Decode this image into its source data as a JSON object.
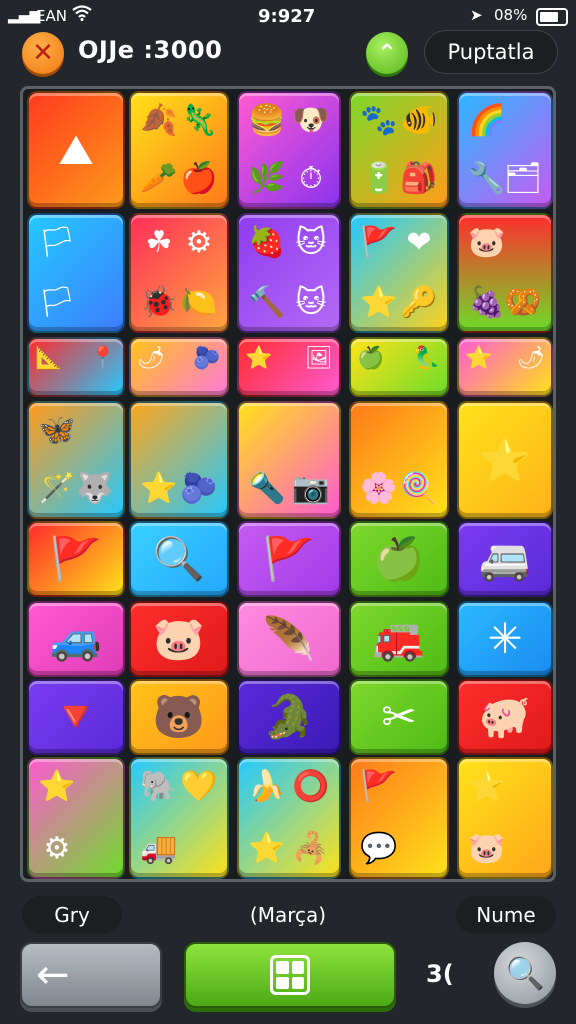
{
  "status_bar": {
    "signal": "▂▄▆",
    "carrier": "EAN",
    "wifi": "wifi",
    "time": "9:927",
    "battery": "08%"
  },
  "header": {
    "close_icon": "✕",
    "score_label": "OJJe :3000",
    "up_icon": "⌃",
    "right_button": "Puptatla"
  },
  "board": {
    "rows": [
      [
        {
          "bg": "linear-gradient(135deg,#ff3b1e,#ff9a1a)",
          "icons": [
            {
              "pos": "c",
              "glyph": "⛰"
            }
          ]
        },
        {
          "bg": "linear-gradient(135deg,#ffe21a,#ff7a1a)",
          "icons": [
            {
              "pos": "tl",
              "glyph": "🍂"
            },
            {
              "pos": "tr",
              "glyph": "🦎"
            },
            {
              "pos": "bl",
              "glyph": "🥕"
            },
            {
              "pos": "br",
              "glyph": "🍎"
            }
          ]
        },
        {
          "bg": "linear-gradient(135deg,#ff5ad1,#8a34f0)",
          "icons": [
            {
              "pos": "tl",
              "glyph": "🍔"
            },
            {
              "pos": "tr",
              "glyph": "🐶"
            },
            {
              "pos": "bl",
              "glyph": "🌿"
            },
            {
              "pos": "br",
              "glyph": "⏱"
            }
          ]
        },
        {
          "bg": "linear-gradient(135deg,#7ed82a,#ff9c1a)",
          "icons": [
            {
              "pos": "tl",
              "glyph": "🐾"
            },
            {
              "pos": "tr",
              "glyph": "🐠"
            },
            {
              "pos": "bl",
              "glyph": "🔋"
            },
            {
              "pos": "br",
              "glyph": "🎒"
            }
          ]
        },
        {
          "bg": "linear-gradient(135deg,#2ab8ff,#c95af2)",
          "icons": [
            {
              "pos": "tl",
              "glyph": "🌈"
            },
            {
              "pos": "bl",
              "glyph": "🔧"
            },
            {
              "pos": "br",
              "glyph": "🗂"
            }
          ]
        }
      ],
      [
        {
          "bg": "linear-gradient(135deg,#24c9ff,#3d7dff)",
          "icons": [
            {
              "pos": "tl",
              "glyph": "🏳"
            },
            {
              "pos": "bl",
              "glyph": "🏳"
            }
          ]
        },
        {
          "bg": "linear-gradient(135deg,#ff2d5a,#ffa640)",
          "icons": [
            {
              "pos": "tl",
              "glyph": "☘"
            },
            {
              "pos": "tr",
              "glyph": "⚙"
            },
            {
              "pos": "bl",
              "glyph": "🐞"
            },
            {
              "pos": "br",
              "glyph": "🍋"
            }
          ]
        },
        {
          "bg": "linear-gradient(135deg,#8f3cf0,#b56af5)",
          "icons": [
            {
              "pos": "tl",
              "glyph": "🍓"
            },
            {
              "pos": "tr",
              "glyph": "🐱"
            },
            {
              "pos": "bl",
              "glyph": "🔨"
            },
            {
              "pos": "br",
              "glyph": "🐱"
            }
          ]
        },
        {
          "bg": "linear-gradient(135deg,#22c8ff,#ffd21a)",
          "icons": [
            {
              "pos": "tl",
              "glyph": "🚩"
            },
            {
              "pos": "tr",
              "glyph": "❤"
            },
            {
              "pos": "bl",
              "glyph": "⭐"
            },
            {
              "pos": "br",
              "glyph": "🔑"
            }
          ]
        },
        {
          "bg": "linear-gradient(180deg,#ff2d2d,#6edc2a)",
          "icons": [
            {
              "pos": "tl",
              "glyph": "🐷"
            },
            {
              "pos": "bl",
              "glyph": "🍇"
            },
            {
              "pos": "br",
              "glyph": "🥨"
            }
          ]
        }
      ],
      [
        {
          "bg": "linear-gradient(135deg,#ff2a2a,#24c9ff)",
          "icons": [
            {
              "pos": "tl",
              "glyph": "📐"
            },
            {
              "pos": "tr",
              "glyph": "📍"
            },
            {
              "pos": "bl",
              "glyph": "🥚"
            },
            {
              "pos": "br",
              "glyph": "🍫"
            }
          ]
        },
        {
          "bg": "linear-gradient(135deg,#ffc21a,#ff7ad8)",
          "icons": [
            {
              "pos": "tl",
              "glyph": "🌶"
            },
            {
              "pos": "tr",
              "glyph": "🫐"
            },
            {
              "pos": "bl",
              "glyph": "🍒"
            },
            {
              "pos": "br",
              "glyph": "🍁"
            }
          ]
        },
        {
          "bg": "linear-gradient(135deg,#ff2d2d,#ff5ad1)",
          "icons": [
            {
              "pos": "tl",
              "glyph": "⭐"
            },
            {
              "pos": "tr",
              "glyph": "🖼"
            },
            {
              "pos": "bl",
              "glyph": "🚩"
            },
            {
              "pos": "br",
              "glyph": "🐢"
            }
          ]
        },
        {
          "bg": "linear-gradient(135deg,#ffe21a,#6edc2a)",
          "icons": [
            {
              "pos": "tl",
              "glyph": "🍏"
            },
            {
              "pos": "tr",
              "glyph": "🦜"
            },
            {
              "pos": "bl",
              "glyph": "🥕"
            },
            {
              "pos": "br",
              "glyph": "⭐"
            }
          ]
        },
        {
          "bg": "linear-gradient(135deg,#ff5ad1,#ffe21a)",
          "icons": [
            {
              "pos": "tl",
              "glyph": "⭐"
            },
            {
              "pos": "tr",
              "glyph": "🌶"
            },
            {
              "pos": "bl",
              "glyph": "🦄"
            },
            {
              "pos": "br",
              "glyph": "🚌"
            }
          ]
        }
      ],
      [
        {
          "bg": "linear-gradient(135deg,#ff9a1a,#24c9ff)",
          "icons": [
            {
              "pos": "tl",
              "glyph": "🦋"
            },
            {
              "pos": "bl",
              "glyph": "🪄"
            },
            {
              "pos": "br",
              "glyph": "🐺"
            }
          ]
        },
        {
          "bg": "linear-gradient(135deg,#ffa61a,#24c9ff)",
          "icons": [
            {
              "pos": "bl",
              "glyph": "⭐"
            },
            {
              "pos": "br",
              "glyph": "🫐"
            }
          ]
        },
        {
          "bg": "linear-gradient(135deg,#ffe21a,#ff5ad1)",
          "icons": [
            {
              "pos": "bl",
              "glyph": "🔦"
            },
            {
              "pos": "br",
              "glyph": "📷"
            }
          ]
        },
        {
          "bg": "linear-gradient(135deg,#ff7a1a,#ffe21a)",
          "icons": [
            {
              "pos": "bl",
              "glyph": "🌸"
            },
            {
              "pos": "br",
              "glyph": "🍭"
            }
          ]
        },
        {
          "bg": "linear-gradient(135deg,#ffe21a,#ffb21a)",
          "icons": [
            {
              "pos": "c",
              "glyph": "⭐"
            }
          ]
        }
      ],
      [
        {
          "bg": "linear-gradient(135deg,#ff2a2a,#ffe21a)",
          "icons": [
            {
              "pos": "c",
              "glyph": "🚩"
            }
          ]
        },
        {
          "bg": "linear-gradient(135deg,#3ad0ff,#24a8ff)",
          "icons": [
            {
              "pos": "c",
              "glyph": "🔍"
            }
          ]
        },
        {
          "bg": "linear-gradient(135deg,#c65af2,#a23ce8)",
          "icons": [
            {
              "pos": "c",
              "glyph": "🚩"
            }
          ]
        },
        {
          "bg": "linear-gradient(135deg,#7ed82a,#4fbb17)",
          "icons": [
            {
              "pos": "c",
              "glyph": "🍏"
            }
          ]
        },
        {
          "bg": "linear-gradient(135deg,#7a3cf0,#5a2ad8)",
          "icons": [
            {
              "pos": "c",
              "glyph": "🚐"
            }
          ]
        }
      ],
      [
        {
          "bg": "linear-gradient(135deg,#ff5ad1,#e03cb8)",
          "icons": [
            {
              "pos": "c",
              "glyph": "🚙"
            }
          ]
        },
        {
          "bg": "linear-gradient(135deg,#ff2d2d,#e01a1a)",
          "icons": [
            {
              "pos": "c",
              "glyph": "🐷"
            }
          ]
        },
        {
          "bg": "linear-gradient(135deg,#ff8ae0,#f06ad0)",
          "icons": [
            {
              "pos": "c",
              "glyph": "🪶"
            }
          ]
        },
        {
          "bg": "linear-gradient(135deg,#7ed82a,#4fbb17)",
          "icons": [
            {
              "pos": "c",
              "glyph": "🚒"
            }
          ]
        },
        {
          "bg": "linear-gradient(135deg,#2ab8ff,#1a8cf0)",
          "icons": [
            {
              "pos": "c",
              "glyph": "✳"
            }
          ]
        }
      ],
      [
        {
          "bg": "linear-gradient(135deg,#7a3cf0,#5a2ad8)",
          "icons": [
            {
              "pos": "c",
              "glyph": "🔻"
            }
          ]
        },
        {
          "bg": "linear-gradient(135deg,#ffc21a,#ff9a1a)",
          "icons": [
            {
              "pos": "c",
              "glyph": "🐻"
            }
          ]
        },
        {
          "bg": "linear-gradient(135deg,#5a2ad8,#3a1ab8)",
          "icons": [
            {
              "pos": "c",
              "glyph": "🐊"
            }
          ]
        },
        {
          "bg": "linear-gradient(135deg,#7ed82a,#4fbb17)",
          "icons": [
            {
              "pos": "c",
              "glyph": "✂"
            }
          ]
        },
        {
          "bg": "linear-gradient(135deg,#ff2d2d,#e01a1a)",
          "icons": [
            {
              "pos": "c",
              "glyph": "🐖"
            }
          ]
        }
      ],
      [
        {
          "bg": "linear-gradient(135deg,#ff5ad1,#6edc2a)",
          "icons": [
            {
              "pos": "tl",
              "glyph": "⭐"
            },
            {
              "pos": "bl",
              "glyph": "⚙"
            }
          ]
        },
        {
          "bg": "linear-gradient(135deg,#24c9ff,#ffe21a)",
          "icons": [
            {
              "pos": "tl",
              "glyph": "🐘"
            },
            {
              "pos": "tr",
              "glyph": "💛"
            },
            {
              "pos": "bl",
              "glyph": "🚚"
            }
          ]
        },
        {
          "bg": "linear-gradient(135deg,#24c9ff,#ffe21a)",
          "icons": [
            {
              "pos": "tl",
              "glyph": "🍌"
            },
            {
              "pos": "tr",
              "glyph": "⭕"
            },
            {
              "pos": "bl",
              "glyph": "⭐"
            },
            {
              "pos": "br",
              "glyph": "🦂"
            }
          ]
        },
        {
          "bg": "linear-gradient(135deg,#ff7a1a,#ffe21a)",
          "icons": [
            {
              "pos": "tl",
              "glyph": "🚩"
            },
            {
              "pos": "bl",
              "glyph": "💬"
            }
          ]
        },
        {
          "bg": "linear-gradient(135deg,#ffe21a,#ffa61a)",
          "icons": [
            {
              "pos": "tl",
              "glyph": "⭐"
            },
            {
              "pos": "bl",
              "glyph": "🐷"
            }
          ]
        }
      ]
    ]
  },
  "footer": {
    "left_label": "Gry",
    "center_label": "(Marça)",
    "right_label": "Nume",
    "back_icon": "←",
    "count": "3(",
    "search_icon": "🔍"
  }
}
